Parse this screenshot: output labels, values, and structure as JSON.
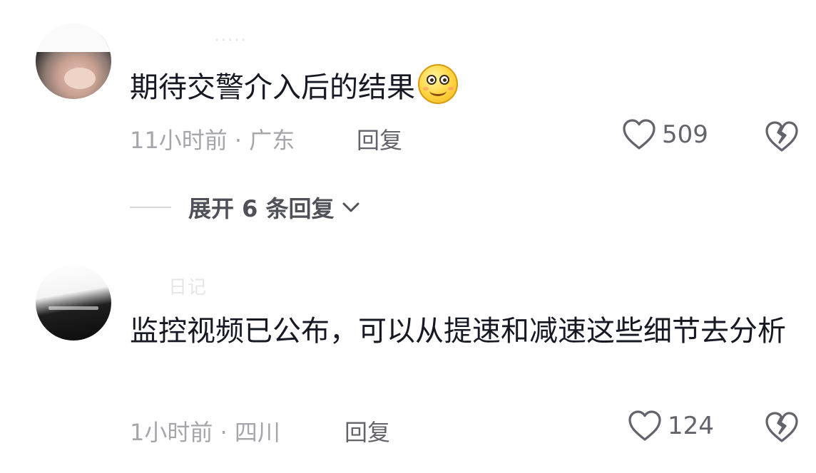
{
  "comments": [
    {
      "username": "·····",
      "content": "期待交警介入后的结果",
      "emoji": "smiling-face-emoji",
      "time_location": "11小时前 · 广东",
      "reply_label": "回复",
      "likes": "509",
      "expand_label": "展开 6 条回复"
    },
    {
      "username": "　　日记",
      "content": "监控视频已公布，可以从提速和减速这些细节去分析",
      "time_location": "1小时前 · 四川",
      "reply_label": "回复",
      "likes": "124"
    }
  ],
  "icons": {
    "like": "heart-outline-icon",
    "dislike": "broken-heart-icon",
    "expand": "chevron-down-icon"
  },
  "colors": {
    "text_primary": "#161823",
    "text_secondary": "#a5a6ab",
    "reply": "#62636b",
    "background": "#ffffff"
  }
}
